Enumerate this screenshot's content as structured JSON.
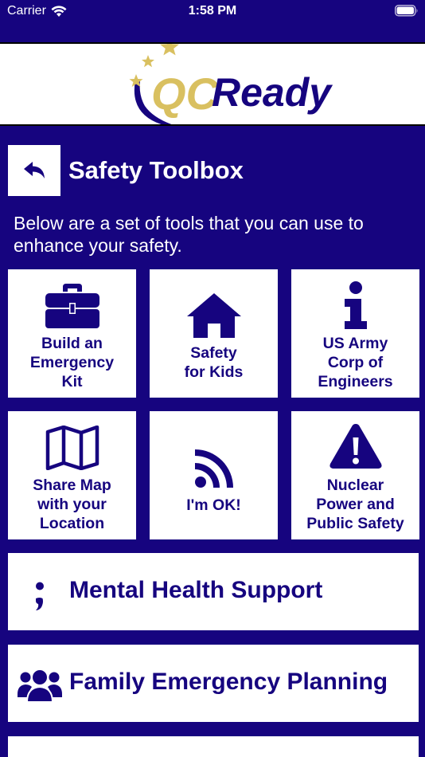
{
  "status_bar": {
    "carrier": "Carrier",
    "time": "1:58 PM"
  },
  "logo": {
    "qc": "QC",
    "ready": "Ready"
  },
  "header": {
    "title": "Safety Toolbox"
  },
  "intro": "Below are a set of tools that you can use to enhance your safety.",
  "tiles": [
    {
      "label": "Build an\nEmergency\nKit",
      "icon": "toolbox-icon"
    },
    {
      "label": "Safety\nfor Kids",
      "icon": "home-icon"
    },
    {
      "label": "US Army\nCorp of\nEngineers",
      "icon": "info-icon"
    },
    {
      "label": "Share Map\nwith your\nLocation",
      "icon": "map-icon"
    },
    {
      "label": "I'm OK!",
      "icon": "rss-icon"
    },
    {
      "label": "Nuclear\nPower and\nPublic Safety",
      "icon": "warning-icon"
    }
  ],
  "wide_buttons": [
    {
      "label": "Mental Health Support",
      "icon": "semicolon-icon"
    },
    {
      "label": "Family Emergency Planning",
      "icon": "users-icon"
    }
  ],
  "colors": {
    "brand": "#16047f",
    "gold": "#d9c060",
    "white": "#ffffff"
  }
}
